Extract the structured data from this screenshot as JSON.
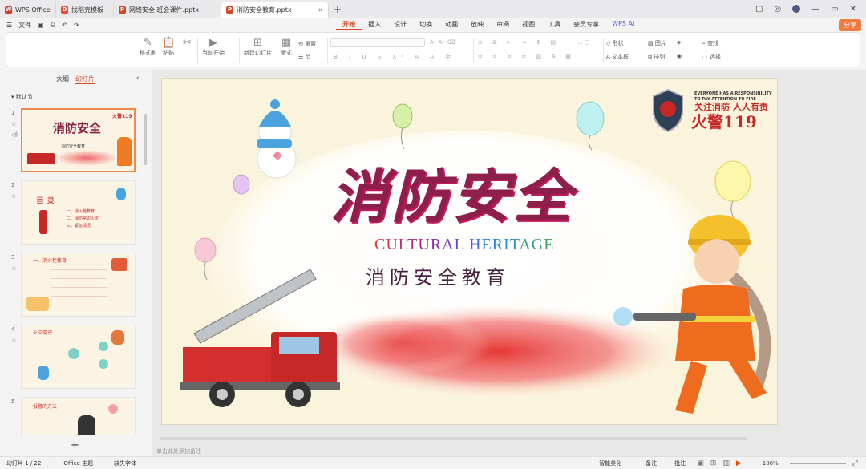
{
  "tabs": [
    {
      "label": "WPS Office",
      "color": "#d33a2c",
      "icon": "W"
    },
    {
      "label": "找稻壳模板",
      "color": "#e34b3c",
      "icon": "D"
    },
    {
      "label": "网络安全 班会课件.pptx",
      "color": "#d24726",
      "icon": "P"
    },
    {
      "label": "消防安全教育.pptx",
      "color": "#d24726",
      "icon": "P"
    }
  ],
  "menu": {
    "file": "文件",
    "share": "分享",
    "wps_ai": "WPS AI",
    "tabs": [
      "开始",
      "插入",
      "设计",
      "切换",
      "动画",
      "放映",
      "审阅",
      "视图",
      "工具",
      "会员专享"
    ]
  },
  "ribbon": {
    "format_painter": "格式刷",
    "paste": "粘贴",
    "play": "当前开始",
    "new_slide": "新建幻灯片",
    "layout": "版式",
    "section": "节",
    "reset": "重置",
    "shape": "形状",
    "picture": "图片",
    "textbox": "文本框",
    "arrange": "排列",
    "find": "查找",
    "select": "选择"
  },
  "left": {
    "outline": "大纲",
    "slides": "幻灯片",
    "section": "默认节",
    "add": "+"
  },
  "thumbs": [
    {
      "n": "1",
      "title": "消防安全",
      "sub": "消防安全教育"
    },
    {
      "n": "2",
      "title": "目 录",
      "items": [
        "一、消火栓教育",
        "二、消防常识火灾",
        "三、紧急情况"
      ]
    },
    {
      "n": "3",
      "title": "一、消火栓教育"
    },
    {
      "n": "4",
      "title": "火灾常识"
    },
    {
      "n": "5",
      "title": "报警的方法"
    }
  ],
  "slide": {
    "title": "消防安全",
    "subtitle_en": "CULTURAL HERITAGE",
    "subtitle_cn": "消防安全教育",
    "badge_en1": "EVERYONE HAS A RESPONSIBILITY",
    "badge_en2": "TO PAY ATTENTION TO FIRE",
    "badge_cn": "关注消防 人人有责",
    "badge_num": "火警119"
  },
  "notes": "单击此处添加备注",
  "status": {
    "slide": "幻灯片 1 / 22",
    "theme": "Office 主题",
    "font": "缺失字体",
    "beautify": "智能美化",
    "notes": "备注",
    "comments": "批注",
    "zoom": "106%"
  }
}
